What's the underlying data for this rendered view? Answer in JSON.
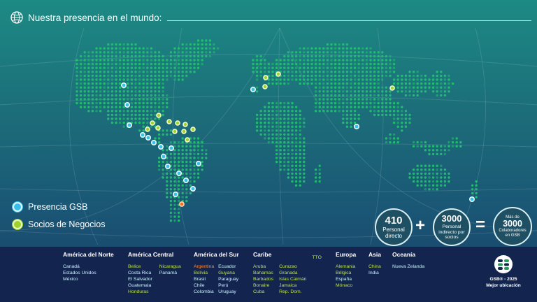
{
  "header": {
    "title": "Nuestra presencia en el mundo:",
    "icon": "globe-icon"
  },
  "legend": {
    "gsb": {
      "label": "Presencia GSB",
      "color": "#36c0e8"
    },
    "socios": {
      "label": "Socios de Negocios",
      "color": "#9cd22b"
    }
  },
  "stats": {
    "directo": {
      "number": "410",
      "line1": "Personal",
      "line2": "directo"
    },
    "indirecto": {
      "number": "3000",
      "line1": "Personal",
      "line2": "indirecto por",
      "line3": "socios"
    },
    "total": {
      "prefix": "Más de",
      "number": "3000",
      "line1": "Colaboradores",
      "line2": "en GSB"
    },
    "plus": "+",
    "equals": "="
  },
  "regions": [
    {
      "title": "América del Norte",
      "columns": [
        [
          {
            "name": "Canadá",
            "kind": "gsb"
          },
          {
            "name": "Estados Unidos",
            "kind": "gsb"
          },
          {
            "name": "México",
            "kind": "gsb"
          }
        ]
      ]
    },
    {
      "title": "América Central",
      "columns": [
        [
          {
            "name": "Belice",
            "kind": "socio"
          },
          {
            "name": "Costa Rica",
            "kind": "gsb"
          },
          {
            "name": "El Salvador",
            "kind": "gsb"
          },
          {
            "name": "Guatemala",
            "kind": "gsb"
          },
          {
            "name": "Honduras",
            "kind": "socio"
          }
        ],
        [
          {
            "name": "Nicaragua",
            "kind": "socio"
          },
          {
            "name": "Panamá",
            "kind": "gsb"
          }
        ]
      ]
    },
    {
      "title": "América del Sur",
      "columns": [
        [
          {
            "name": "Argentina",
            "kind": "hl"
          },
          {
            "name": "Bolivia",
            "kind": "socio"
          },
          {
            "name": "Brasil",
            "kind": "gsb"
          },
          {
            "name": "Chile",
            "kind": "gsb"
          },
          {
            "name": "Colombia",
            "kind": "gsb"
          }
        ],
        [
          {
            "name": "Ecuador",
            "kind": "gsb"
          },
          {
            "name": "Guyana",
            "kind": "socio"
          },
          {
            "name": "Paraguay",
            "kind": "gsb"
          },
          {
            "name": "Perú",
            "kind": "gsb"
          },
          {
            "name": "Uruguay",
            "kind": "gsb"
          }
        ]
      ]
    },
    {
      "title": "Caribe",
      "columns": [
        [
          {
            "name": "Aruba",
            "kind": "socio"
          },
          {
            "name": "Bahamas",
            "kind": "socio"
          },
          {
            "name": "Barbados",
            "kind": "socio"
          },
          {
            "name": "Bonaire",
            "kind": "socio"
          },
          {
            "name": "Cuba",
            "kind": "socio"
          }
        ],
        [
          {
            "name": "Curazao",
            "kind": "socio"
          },
          {
            "name": "Granada",
            "kind": "socio"
          },
          {
            "name": "Islas Caimán",
            "kind": "socio"
          },
          {
            "name": "Jamaica",
            "kind": "socio"
          },
          {
            "name": "Rep. Dom.",
            "kind": "socio"
          }
        ],
        [
          {
            "name": "TTO",
            "kind": "socio"
          }
        ]
      ]
    },
    {
      "title": "Europa",
      "columns": [
        [
          {
            "name": "Alemania",
            "kind": "socio"
          },
          {
            "name": "Bélgica",
            "kind": "socio"
          },
          {
            "name": "España",
            "kind": "gsb"
          },
          {
            "name": "Mónaco",
            "kind": "socio"
          }
        ]
      ]
    },
    {
      "title": "Asia",
      "columns": [
        [
          {
            "name": "China",
            "kind": "socio"
          },
          {
            "name": "India",
            "kind": "gsb"
          }
        ]
      ]
    },
    {
      "title": "Oceanía",
      "columns": [
        [
          {
            "name": "Nueva Zelanda",
            "kind": "gsb"
          }
        ]
      ]
    }
  ],
  "badge": {
    "line1": "GSB® - 2025",
    "line2": "Mejor ubicación",
    "icon": "gsb-logo-icon"
  },
  "colors": {
    "gsb": "#36c0e8",
    "socio": "#9cd22b",
    "highlight": "#ff6a1a",
    "land_dot": "#1cc36a",
    "footer": "#13254f"
  }
}
